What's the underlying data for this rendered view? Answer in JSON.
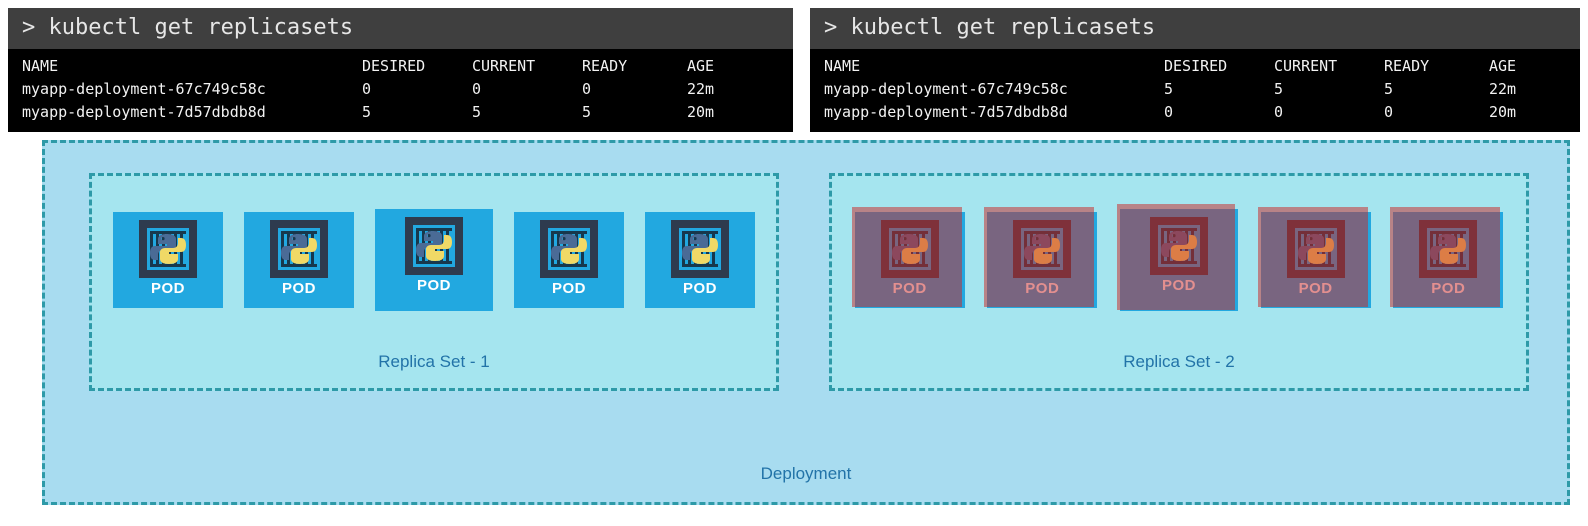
{
  "terminals": [
    {
      "name": "left-terminal",
      "prompt": "> kubectl get replicasets",
      "columns": [
        "NAME",
        "DESIRED",
        "CURRENT",
        "READY",
        "AGE"
      ],
      "rows": [
        {
          "name": "myapp-deployment-67c749c58c",
          "desired": "0",
          "current": "0",
          "ready": "0",
          "age": "22m"
        },
        {
          "name": "myapp-deployment-7d57dbdb8d",
          "desired": "5",
          "current": "5",
          "ready": "5",
          "age": "20m"
        }
      ]
    },
    {
      "name": "right-terminal",
      "prompt": "> kubectl get replicasets",
      "columns": [
        "NAME",
        "DESIRED",
        "CURRENT",
        "READY",
        "AGE"
      ],
      "rows": [
        {
          "name": "myapp-deployment-67c749c58c",
          "desired": "5",
          "current": "5",
          "ready": "5",
          "age": "22m"
        },
        {
          "name": "myapp-deployment-7d57dbdb8d",
          "desired": "0",
          "current": "0",
          "ready": "0",
          "age": "20m"
        }
      ]
    }
  ],
  "diagram": {
    "deployment_label": "Deployment",
    "replicasets": [
      {
        "label": "Replica Set - 1",
        "state": "active",
        "pod_count": 5,
        "pods": [
          {
            "label": "POD",
            "icon": "python-container-icon",
            "state": "running"
          },
          {
            "label": "POD",
            "icon": "python-container-icon",
            "state": "running"
          },
          {
            "label": "POD",
            "icon": "python-container-icon",
            "state": "running"
          },
          {
            "label": "POD",
            "icon": "python-container-icon",
            "state": "running"
          },
          {
            "label": "POD",
            "icon": "python-container-icon",
            "state": "running"
          }
        ]
      },
      {
        "label": "Replica Set - 2",
        "state": "scaled-down",
        "pod_count": 5,
        "pods": [
          {
            "label": "POD",
            "icon": "python-container-icon",
            "state": "terminating"
          },
          {
            "label": "POD",
            "icon": "python-container-icon",
            "state": "terminating"
          },
          {
            "label": "POD",
            "icon": "python-container-icon",
            "state": "terminating"
          },
          {
            "label": "POD",
            "icon": "python-container-icon",
            "state": "terminating"
          },
          {
            "label": "POD",
            "icon": "python-container-icon",
            "state": "terminating"
          }
        ]
      }
    ]
  },
  "colors": {
    "deployment_bg": "#a8dcf0",
    "replicaset_bg": "#a5e5ef",
    "dash_border": "#2e9aa8",
    "label_text": "#2273a8",
    "pod_bg": "#22a8e0",
    "pod_frame": "#2e3b4e",
    "terminating_overlay": "#c92828",
    "terminal_header_bg": "#3f3f3f",
    "terminal_body_bg": "#000000",
    "terminal_text": "#f2f2f2"
  }
}
